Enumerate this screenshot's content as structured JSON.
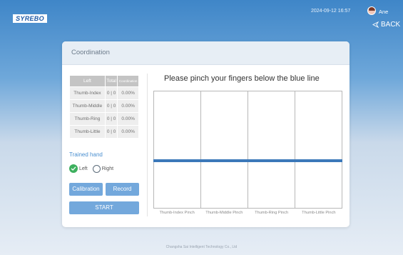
{
  "app": {
    "logo": "SYREBO"
  },
  "header": {
    "datetime": "2024-09-12 16:57",
    "user": "Ane",
    "back_label": "BACK"
  },
  "card": {
    "title": "Coordination"
  },
  "stats": {
    "headers": [
      "Left",
      "Total",
      "Coordination"
    ],
    "rows": [
      {
        "finger": "Thumb-Index",
        "total": "0 | 0",
        "pct": "0.00%"
      },
      {
        "finger": "Thumb-Middle",
        "total": "0 | 0",
        "pct": "0.00%"
      },
      {
        "finger": "Thumb-Ring",
        "total": "0 | 0",
        "pct": "0.00%"
      },
      {
        "finger": "Thumb-Little",
        "total": "0 | 0",
        "pct": "0.00%"
      }
    ]
  },
  "trained_hand": {
    "label": "Trained hand",
    "options": [
      "Left",
      "Right"
    ],
    "selected": "Left"
  },
  "buttons": {
    "calibration": "Calibration",
    "record": "Record",
    "start": "START"
  },
  "instruction": "Please pinch your fingers below the blue line",
  "pinch_labels": [
    "Thumb-Index Pinch",
    "Thumb-Middle Pinch",
    "Thumb-Ring Pinch",
    "Thumb-Little Pinch"
  ],
  "footer": "Changsha Sai Intelligent Technology Co., Ltd",
  "colors": {
    "accent": "#73a8dc",
    "line": "#3b78b9",
    "checked": "#3db05e"
  }
}
